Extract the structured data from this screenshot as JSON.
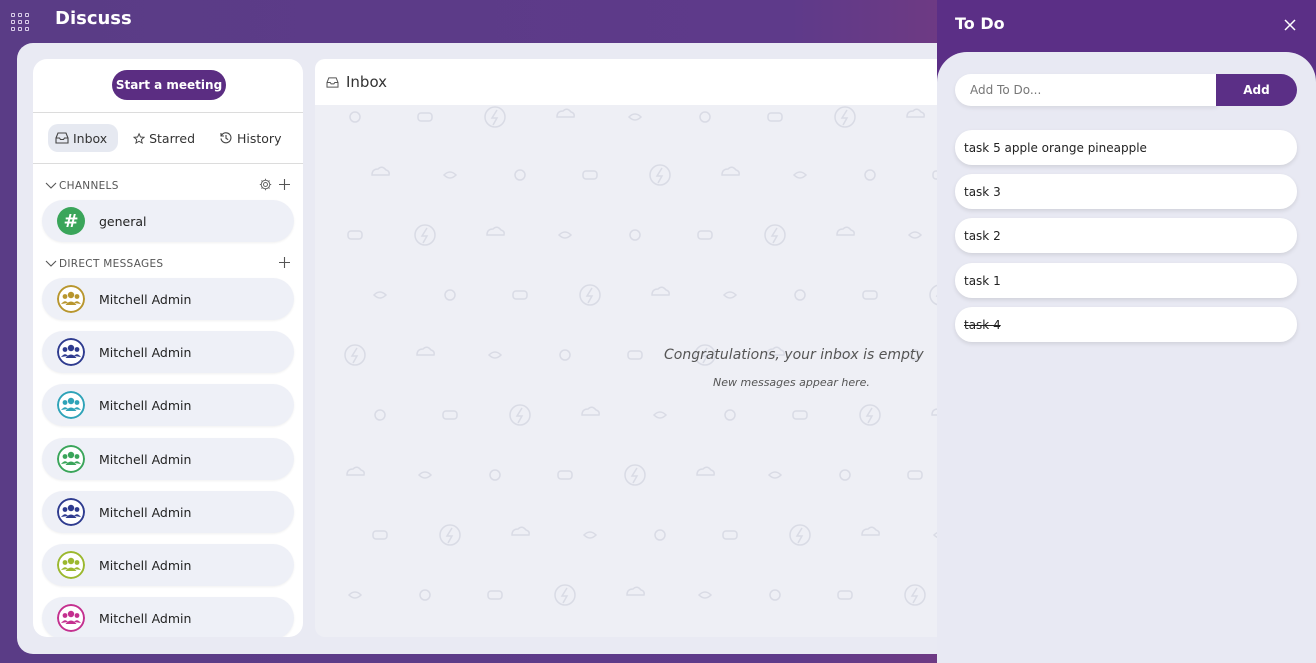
{
  "app": {
    "title": "Discuss"
  },
  "sidebar": {
    "meeting_button": "Start a meeting",
    "nav": [
      {
        "label": "Inbox",
        "icon": "inbox-icon",
        "active": true
      },
      {
        "label": "Starred",
        "icon": "star-icon",
        "active": false
      },
      {
        "label": "History",
        "icon": "history-icon",
        "active": false
      }
    ],
    "channels": {
      "header": "CHANNELS",
      "items": [
        {
          "label": "general",
          "icon": "hash-icon",
          "color": "#3aa55a"
        }
      ]
    },
    "direct_messages": {
      "header": "DIRECT MESSAGES",
      "items": [
        {
          "label": "Mitchell Admin",
          "color": "#b8962e"
        },
        {
          "label": "Mitchell Admin",
          "color": "#2e3b8f"
        },
        {
          "label": "Mitchell Admin",
          "color": "#2ea3b8"
        },
        {
          "label": "Mitchell Admin",
          "color": "#3aa55a"
        },
        {
          "label": "Mitchell Admin",
          "color": "#2e3b8f"
        },
        {
          "label": "Mitchell Admin",
          "color": "#9bb82e"
        },
        {
          "label": "Mitchell Admin",
          "color": "#c4308f"
        }
      ]
    }
  },
  "inbox": {
    "title": "Inbox",
    "empty_title": "Congratulations, your inbox is empty",
    "empty_subtitle": "New messages appear here."
  },
  "todo": {
    "title": "To Do",
    "input_placeholder": "Add To Do...",
    "add_label": "Add",
    "items": [
      {
        "text": "task 5 apple orange pineapple",
        "done": false
      },
      {
        "text": "task 3",
        "done": false
      },
      {
        "text": "task 2",
        "done": false
      },
      {
        "text": "task 1",
        "done": false
      },
      {
        "text": "task 4",
        "done": true
      }
    ]
  },
  "colors": {
    "accent": "#5b2f86",
    "background": "#e9eaf3"
  }
}
